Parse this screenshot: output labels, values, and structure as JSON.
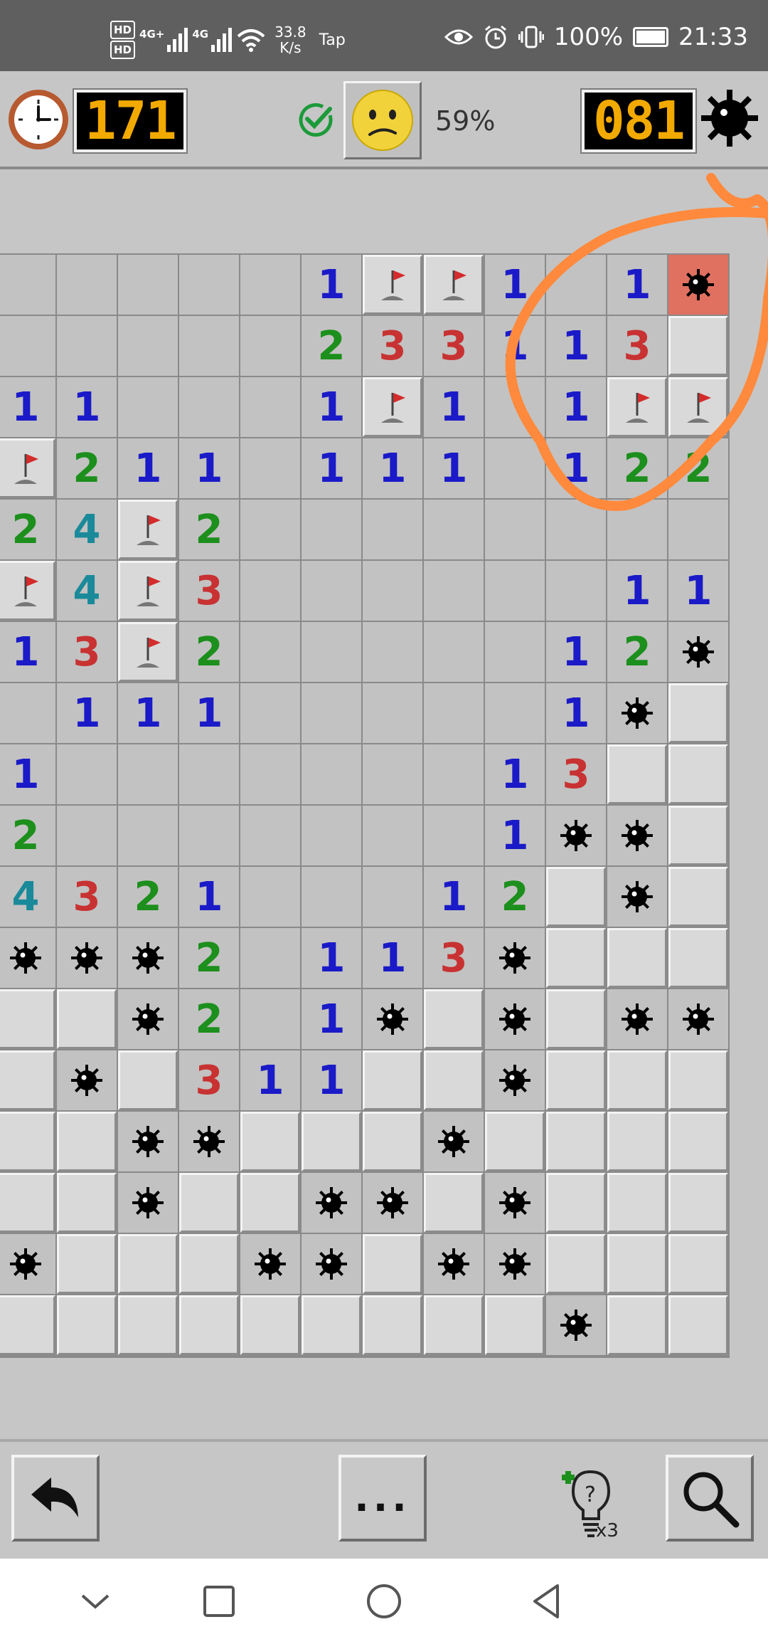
{
  "status_bar": {
    "hd1": "HD",
    "hd2": "HD",
    "net1": "4G+",
    "net2": "4G",
    "speed_value": "33.8",
    "speed_unit": "K/s",
    "tap": "Tap",
    "battery": "100%",
    "time": "21:33"
  },
  "header": {
    "timer": "171",
    "mines_left": "081",
    "progress": "59%"
  },
  "board": {
    "cols": 12,
    "rows": 18,
    "grid": [
      [
        "r",
        "r",
        "r",
        "r",
        "r",
        "1",
        "F",
        "F",
        "1",
        "r",
        "1",
        "X"
      ],
      [
        "r",
        "r",
        "r",
        "r",
        "r",
        "2",
        "3",
        "3",
        "1",
        "1",
        "3",
        "R"
      ],
      [
        "1",
        "1",
        "r",
        "r",
        "r",
        "1",
        "F",
        "1",
        "r",
        "1",
        "F",
        "F"
      ],
      [
        "F",
        "2",
        "1",
        "1",
        "r",
        "1",
        "1",
        "1",
        "r",
        "1",
        "2",
        "2"
      ],
      [
        "2",
        "4",
        "F",
        "2",
        "r",
        "r",
        "r",
        "r",
        "r",
        "r",
        "r",
        "r"
      ],
      [
        "F",
        "4",
        "F",
        "3",
        "r",
        "r",
        "r",
        "r",
        "r",
        "r",
        "1",
        "1"
      ],
      [
        "1",
        "3",
        "F",
        "2",
        "r",
        "r",
        "r",
        "r",
        "r",
        "1",
        "2",
        "M"
      ],
      [
        "r",
        "1",
        "1",
        "1",
        "r",
        "r",
        "r",
        "r",
        "r",
        "1",
        "M",
        "R"
      ],
      [
        "1",
        "r",
        "r",
        "r",
        "r",
        "r",
        "r",
        "r",
        "1",
        "3",
        "R",
        "R"
      ],
      [
        "2",
        "r",
        "r",
        "r",
        "r",
        "r",
        "r",
        "r",
        "1",
        "M",
        "M",
        "R"
      ],
      [
        "4",
        "3",
        "2",
        "1",
        "r",
        "r",
        "r",
        "1",
        "2",
        "R",
        "M",
        "R"
      ],
      [
        "M",
        "M",
        "M",
        "2",
        "r",
        "1",
        "1",
        "3",
        "M",
        "R",
        "R",
        "R"
      ],
      [
        "R",
        "R",
        "M",
        "2",
        "r",
        "1",
        "M",
        "R",
        "M",
        "R",
        "M",
        "M"
      ],
      [
        "R",
        "M",
        "R",
        "3",
        "1",
        "1",
        "R",
        "R",
        "M",
        "R",
        "R",
        "R"
      ],
      [
        "R",
        "R",
        "M",
        "M",
        "R",
        "R",
        "R",
        "M",
        "R",
        "R",
        "R",
        "R"
      ],
      [
        "R",
        "R",
        "M",
        "R",
        "R",
        "M",
        "M",
        "R",
        "M",
        "R",
        "R",
        "R"
      ],
      [
        "M",
        "R",
        "R",
        "R",
        "M",
        "M",
        "R",
        "M",
        "M",
        "R",
        "R",
        "R"
      ],
      [
        "R",
        "R",
        "R",
        "R",
        "R",
        "R",
        "R",
        "R",
        "R",
        "M",
        "R",
        "R"
      ]
    ]
  },
  "toolbar": {
    "more_label": "...",
    "hint_count": "x3"
  },
  "icons": {
    "clock": "clock-icon",
    "check": "check-circle-icon",
    "face": "worried-face-icon",
    "settings": "gear-mine-icon",
    "undo": "undo-arrow-icon",
    "hint": "hint-bulb-icon",
    "search": "magnifier-icon"
  },
  "colors": {
    "lcd_digits": "#f2a900",
    "annotation": "#ff8a3d",
    "num1": "#1a1ac8",
    "num2": "#1c8f1c",
    "num3": "#c83232",
    "num4": "#1a8a9a",
    "hit_cell": "#e07060"
  }
}
